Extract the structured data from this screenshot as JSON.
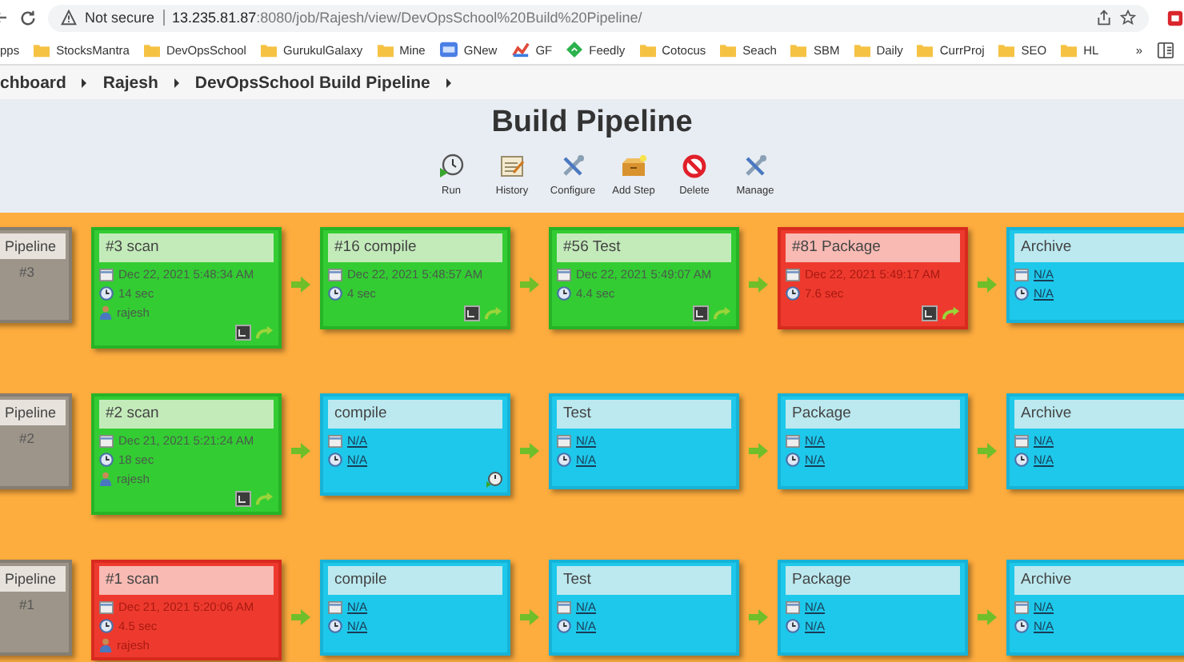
{
  "browser": {
    "security": "Not secure",
    "url_host": "13.235.81.87",
    "url_path": ":8080/job/Rajesh/view/DevOpsSchool%20Build%20Pipeline/",
    "overflow": "»",
    "bookmarks": [
      {
        "label": "pps",
        "kind": "plain"
      },
      {
        "label": "StocksMantra",
        "kind": "folder"
      },
      {
        "label": "DevOpsSchool",
        "kind": "folder"
      },
      {
        "label": "GurukulGalaxy",
        "kind": "folder"
      },
      {
        "label": "Mine",
        "kind": "folder"
      },
      {
        "label": "GNew",
        "kind": "tile"
      },
      {
        "label": "GF",
        "kind": "chart"
      },
      {
        "label": "Feedly",
        "kind": "leaf"
      },
      {
        "label": "Cotocus",
        "kind": "folder"
      },
      {
        "label": "Seach",
        "kind": "folder"
      },
      {
        "label": "SBM",
        "kind": "folder"
      },
      {
        "label": "Daily",
        "kind": "folder"
      },
      {
        "label": "CurrProj",
        "kind": "folder"
      },
      {
        "label": "SEO",
        "kind": "folder"
      },
      {
        "label": "HL",
        "kind": "folder"
      }
    ]
  },
  "breadcrumbs": [
    "chboard",
    "Rajesh",
    "DevOpsSchool Build Pipeline"
  ],
  "title": "Build Pipeline",
  "toolbar": [
    {
      "label": "Run",
      "kind": "run"
    },
    {
      "label": "History",
      "kind": "history"
    },
    {
      "label": "Configure",
      "kind": "configure"
    },
    {
      "label": "Add Step",
      "kind": "add"
    },
    {
      "label": "Delete",
      "kind": "delete"
    },
    {
      "label": "Manage",
      "kind": "configure"
    }
  ],
  "pipelines": [
    {
      "head": {
        "label": "Pipeline",
        "number": "#3"
      },
      "stages": [
        {
          "title": "#3 scan",
          "kind": "success",
          "date": "Dec 22, 2021 5:48:34 AM",
          "duration": "14 sec",
          "user": "rajesh",
          "actions": [
            {
              "kind": "console"
            },
            {
              "kind": "rerun"
            }
          ]
        },
        {
          "title": "#16 compile",
          "kind": "success",
          "date": "Dec 22, 2021 5:48:57 AM",
          "duration": "4 sec",
          "actions": [
            {
              "kind": "console"
            },
            {
              "kind": "rerun"
            }
          ]
        },
        {
          "title": "#56 Test",
          "kind": "success",
          "date": "Dec 22, 2021 5:49:07 AM",
          "duration": "4.4 sec",
          "actions": [
            {
              "kind": "console"
            },
            {
              "kind": "rerun"
            }
          ]
        },
        {
          "title": "#81 Package",
          "kind": "failed",
          "date": "Dec 22, 2021 5:49:17 AM",
          "duration": "7.6 sec",
          "actions": [
            {
              "kind": "console"
            },
            {
              "kind": "rerun"
            }
          ]
        },
        {
          "title": "Archive",
          "kind": "pending",
          "date": "N/A",
          "duration": "N/A"
        }
      ]
    },
    {
      "head": {
        "label": "Pipeline",
        "number": "#2"
      },
      "stages": [
        {
          "title": "#2 scan",
          "kind": "success",
          "date": "Dec 21, 2021 5:21:24 AM",
          "duration": "18 sec",
          "user": "rajesh",
          "actions": [
            {
              "kind": "console"
            },
            {
              "kind": "rerun"
            }
          ]
        },
        {
          "title": "compile",
          "kind": "pending",
          "date": "N/A",
          "duration": "N/A",
          "actions": [
            {
              "kind": "trigger"
            }
          ]
        },
        {
          "title": "Test",
          "kind": "pending",
          "date": "N/A",
          "duration": "N/A"
        },
        {
          "title": "Package",
          "kind": "pending",
          "date": "N/A",
          "duration": "N/A"
        },
        {
          "title": "Archive",
          "kind": "pending",
          "date": "N/A",
          "duration": "N/A"
        }
      ]
    },
    {
      "head": {
        "label": "Pipeline",
        "number": "#1"
      },
      "stages": [
        {
          "title": "#1 scan",
          "kind": "failed",
          "date": "Dec 21, 2021 5:20:06 AM",
          "duration": "4.5 sec",
          "user": "rajesh"
        },
        {
          "title": "compile",
          "kind": "pending",
          "date": "N/A",
          "duration": "N/A"
        },
        {
          "title": "Test",
          "kind": "pending",
          "date": "N/A",
          "duration": "N/A"
        },
        {
          "title": "Package",
          "kind": "pending",
          "date": "N/A",
          "duration": "N/A"
        },
        {
          "title": "Archive",
          "kind": "pending",
          "date": "N/A",
          "duration": "N/A"
        }
      ]
    }
  ]
}
